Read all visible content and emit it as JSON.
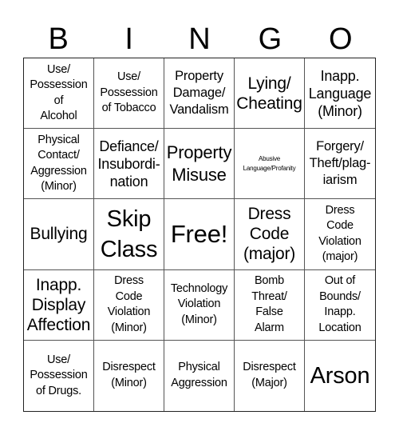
{
  "header": {
    "letters": [
      "B",
      "I",
      "N",
      "G",
      "O"
    ]
  },
  "cells": [
    "Use/\nPossession\nof\nAlcohol",
    "Use/\nPossession\nof Tobacco",
    "Property\nDamage/\nVandalism",
    "Lying/\nCheating",
    "Inapp.\nLanguage\n(Minor)",
    "Physical\nContact/\nAggression\n(Minor)",
    "Defiance/\nInsubordi-\nnation",
    "Property\nMisuse",
    "Abusive\nLanguage/Profanity",
    "Forgery/\nTheft/plag-\niarism",
    "Bullying",
    "Skip\nClass",
    "Free!",
    "Dress\nCode\n(major)",
    "Dress\nCode\nViolation\n(major)",
    "Inapp.\nDisplay\nAffection",
    "Dress\nCode\nViolation\n(Minor)",
    "Technology\nViolation\n(Minor)",
    "Bomb\nThreat/\nFalse\nAlarm",
    "Out of\nBounds/\nInapp.\nLocation",
    "Use/\nPossession\nof Drugs.",
    "Disrespect\n(Minor)",
    "Physical\nAggression",
    "Disrespect\n(Major)",
    "Arson"
  ]
}
